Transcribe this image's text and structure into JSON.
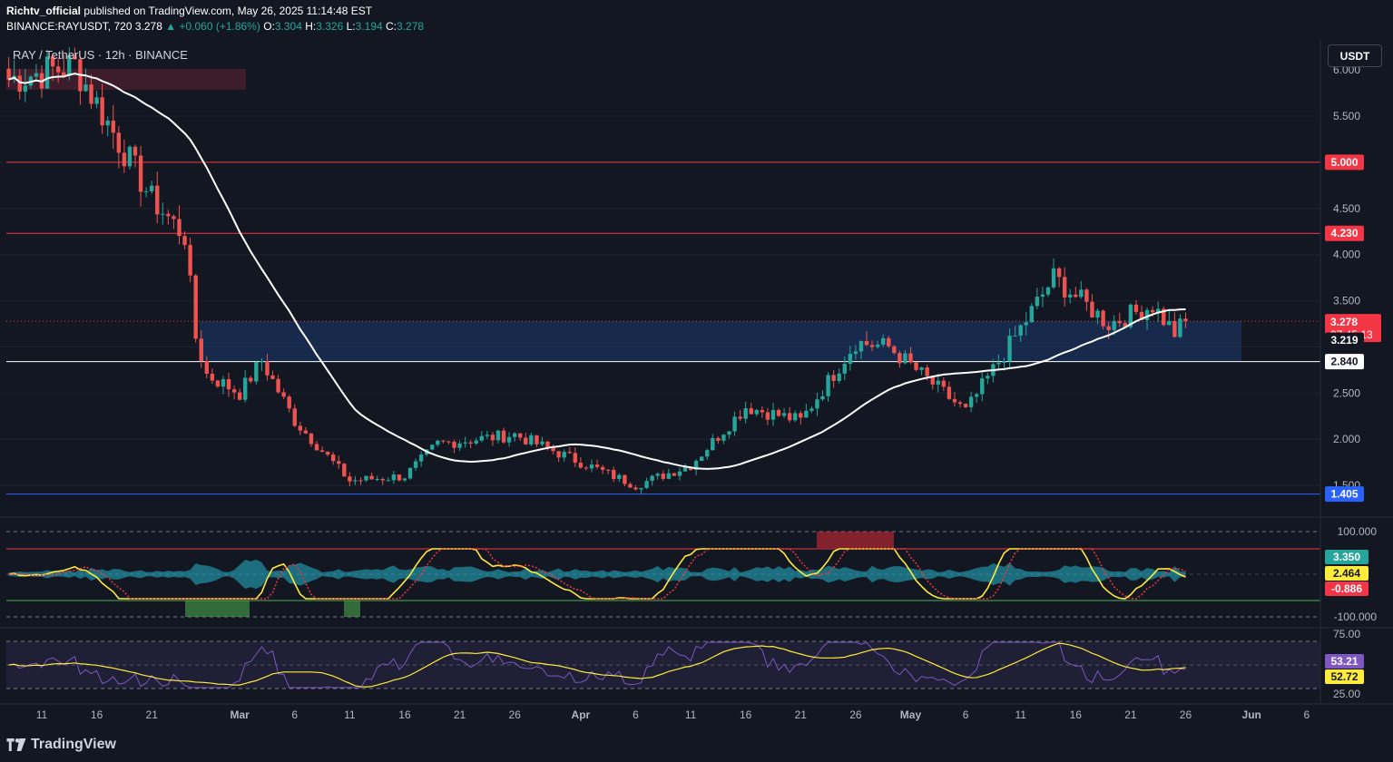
{
  "header": {
    "author": "Richtv_official",
    "published": "published on TradingView.com, May 26, 2025 11:14:48 EST",
    "symbol": "BINANCE:RAYUSDT, 720",
    "last": "3.278",
    "change": "+0.060 (+1.86%)",
    "open": "3.304",
    "high": "3.326",
    "low": "3.194",
    "close": "3.278"
  },
  "symbol_title": "RAY / TetherUS · 12h · BINANCE",
  "currency_button": "USDT",
  "brand": "TradingView",
  "colors": {
    "background": "#131722",
    "up": "#26a69a",
    "down": "#ef5350",
    "resistance": "#f23645",
    "support": "#2962ff",
    "zone": "#1e3a6e",
    "ma": "#ffffff",
    "cci": "#ffeb3b",
    "rsi": "#7e57c2"
  },
  "chart_data": [
    {
      "type": "candlestick",
      "title": "RAY / TetherUS · 12h · BINANCE",
      "y_ticks": [
        "6.000",
        "5.500",
        "4.500",
        "4.000",
        "3.500",
        "2.500",
        "2.000",
        "1.500"
      ],
      "x_ticks": [
        "11",
        "16",
        "21",
        "Mar",
        "6",
        "11",
        "16",
        "21",
        "26",
        "Apr",
        "6",
        "11",
        "16",
        "21",
        "26",
        "May",
        "6",
        "11",
        "16",
        "21",
        "26",
        "Jun",
        "6"
      ],
      "ylim": [
        1.35,
        6.2
      ],
      "moving_average_color": "white",
      "price_levels": [
        {
          "label": "5.000",
          "value": 5.0,
          "color": "#f23645"
        },
        {
          "label": "4.230",
          "value": 4.23,
          "color": "#f23645"
        },
        {
          "label": "2.840",
          "value": 2.84,
          "color": "#ffffff"
        },
        {
          "label": "1.405",
          "value": 1.405,
          "color": "#2962ff"
        }
      ],
      "last_price": {
        "label": "3.278",
        "value": 3.278,
        "countdown": "07:45:13"
      },
      "ma_value": {
        "label": "3.219",
        "value": 3.219
      },
      "zone": {
        "low": 2.84,
        "high": 3.278
      },
      "supply_zone": {
        "low": 5.98,
        "high": 6.2
      },
      "key_points": [
        {
          "date": "Feb 8",
          "value": 5.9
        },
        {
          "date": "Feb 14",
          "value": 6.05
        },
        {
          "date": "Feb 21",
          "value": 4.6
        },
        {
          "date": "Feb 24",
          "value": 4.2
        },
        {
          "date": "Feb 25",
          "value": 3.1
        },
        {
          "date": "Feb 26",
          "value": 2.7
        },
        {
          "date": "Mar 1",
          "value": 2.5
        },
        {
          "date": "Mar 3",
          "value": 2.85
        },
        {
          "date": "Mar 6",
          "value": 2.2
        },
        {
          "date": "Mar 11",
          "value": 1.55
        },
        {
          "date": "Mar 16",
          "value": 1.6
        },
        {
          "date": "Mar 19",
          "value": 1.95
        },
        {
          "date": "Mar 26",
          "value": 2.05
        },
        {
          "date": "Apr 1",
          "value": 1.75
        },
        {
          "date": "Apr 6",
          "value": 1.5
        },
        {
          "date": "Apr 11",
          "value": 1.72
        },
        {
          "date": "Apr 16",
          "value": 2.35
        },
        {
          "date": "Apr 21",
          "value": 2.2
        },
        {
          "date": "Apr 26",
          "value": 3.05
        },
        {
          "date": "Apr 29",
          "value": 3.0
        },
        {
          "date": "May 6",
          "value": 2.3
        },
        {
          "date": "May 11",
          "value": 3.2
        },
        {
          "date": "May 14",
          "value": 3.75
        },
        {
          "date": "May 19",
          "value": 3.25
        },
        {
          "date": "May 23",
          "value": 3.45
        },
        {
          "date": "May 25",
          "value": 3.15
        },
        {
          "date": "May 26",
          "value": 3.278
        }
      ]
    },
    {
      "type": "line",
      "panel": "cci",
      "y_ticks": [
        "100.000",
        "-100.000"
      ],
      "labels": [
        {
          "label": "3.350",
          "color": "#26a69a"
        },
        {
          "label": "2.464",
          "color": "#ffeb3b"
        },
        {
          "label": "-0.886",
          "color": "#f23645"
        }
      ]
    },
    {
      "type": "line",
      "panel": "rsi",
      "y_ticks": [
        "75.00",
        "25.00"
      ],
      "ylim": [
        20,
        80
      ],
      "labels": [
        {
          "label": "53.21",
          "value": 53.21,
          "color": "#7e57c2"
        },
        {
          "label": "52.72",
          "value": 52.72,
          "color": "#ffeb3b"
        }
      ]
    }
  ]
}
